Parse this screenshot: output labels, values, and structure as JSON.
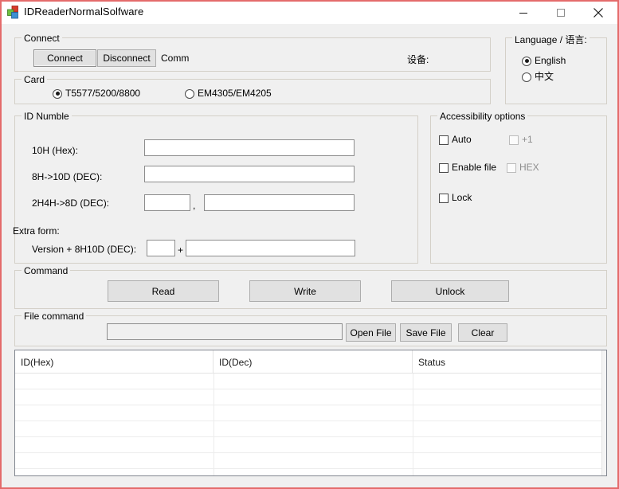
{
  "window": {
    "title": "IDReaderNormalSolfware",
    "icon": "app-blocks-icon",
    "accent_border": "#e46b6b",
    "face_color": "#f0f0f0",
    "controls": {
      "minimize": "minimize-icon",
      "maximize": "maximize-icon",
      "close": "close-icon"
    }
  },
  "connect": {
    "group_title": "Connect",
    "connect_button": "Connect",
    "disconnect_button": "Disconnect",
    "comm_label": "Comm",
    "device_label": "设备:"
  },
  "card": {
    "group_title": "Card",
    "options": [
      {
        "label": "T5577/5200/8800",
        "selected": true
      },
      {
        "label": "EM4305/EM4205",
        "selected": false
      }
    ]
  },
  "language": {
    "group_title": "Language / 语言:",
    "options": [
      {
        "label": "English",
        "selected": true
      },
      {
        "label": "中文",
        "selected": false
      }
    ]
  },
  "id_number": {
    "group_title": "ID Numble",
    "rows": [
      {
        "label": "10H (Hex):",
        "value": "",
        "placeholder": ""
      },
      {
        "label": "8H->10D (DEC):",
        "value": "",
        "placeholder": ""
      },
      {
        "label": "2H4H->8D (DEC):",
        "value_a": "",
        "separator": ",",
        "value_b": ""
      }
    ],
    "extra_form_label": "Extra form:",
    "extra_row": {
      "label": "Version + 8H10D (DEC):",
      "value_a": "",
      "separator": "+",
      "value_b": ""
    }
  },
  "accessibility": {
    "group_title": "Accessibility options",
    "items": [
      {
        "label": "Auto",
        "checked": false,
        "enabled": true
      },
      {
        "label": "+1",
        "checked": false,
        "enabled": false
      },
      {
        "label": "Enable file",
        "checked": false,
        "enabled": true
      },
      {
        "label": "HEX",
        "checked": false,
        "enabled": false
      },
      {
        "label": "Lock",
        "checked": false,
        "enabled": true
      }
    ]
  },
  "command": {
    "group_title": "Command",
    "buttons": [
      {
        "label": "Read"
      },
      {
        "label": "Write"
      },
      {
        "label": "Unlock"
      }
    ]
  },
  "file_command": {
    "group_title": "File command",
    "path_value": "",
    "path_placeholder": "",
    "buttons": [
      {
        "label": "Open File"
      },
      {
        "label": "Save File"
      },
      {
        "label": "Clear"
      }
    ]
  },
  "results": {
    "columns": [
      "ID(Hex)",
      "ID(Dec)",
      "Status"
    ],
    "rows": []
  }
}
